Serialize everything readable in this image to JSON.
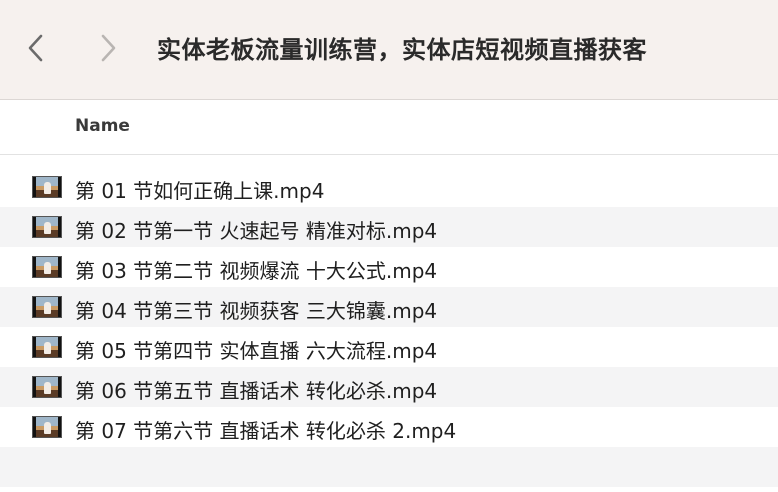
{
  "window": {
    "title": "实体老板流量训练营，实体店短视频直播获客"
  },
  "toolbar": {
    "back_icon": "chevron-left-icon",
    "forward_icon": "chevron-right-icon"
  },
  "columns": {
    "name": "Name"
  },
  "files": [
    {
      "name": "第 01 节如何正确上课.mp4"
    },
    {
      "name": "第 02 节第一节 火速起号 精准对标.mp4"
    },
    {
      "name": "第 03 节第二节 视频爆流 十大公式.mp4"
    },
    {
      "name": "第 04 节第三节 视频获客 三大锦囊.mp4"
    },
    {
      "name": "第 05 节第四节 实体直播 六大流程.mp4"
    },
    {
      "name": "第 06 节第五节 直播话术 转化必杀.mp4"
    },
    {
      "name": "第 07 节第六节 直播话术 转化必杀 2.mp4"
    }
  ],
  "colors": {
    "toolbar_bg": "#f6f1ee",
    "alt_row_bg": "#f4f4f5"
  }
}
